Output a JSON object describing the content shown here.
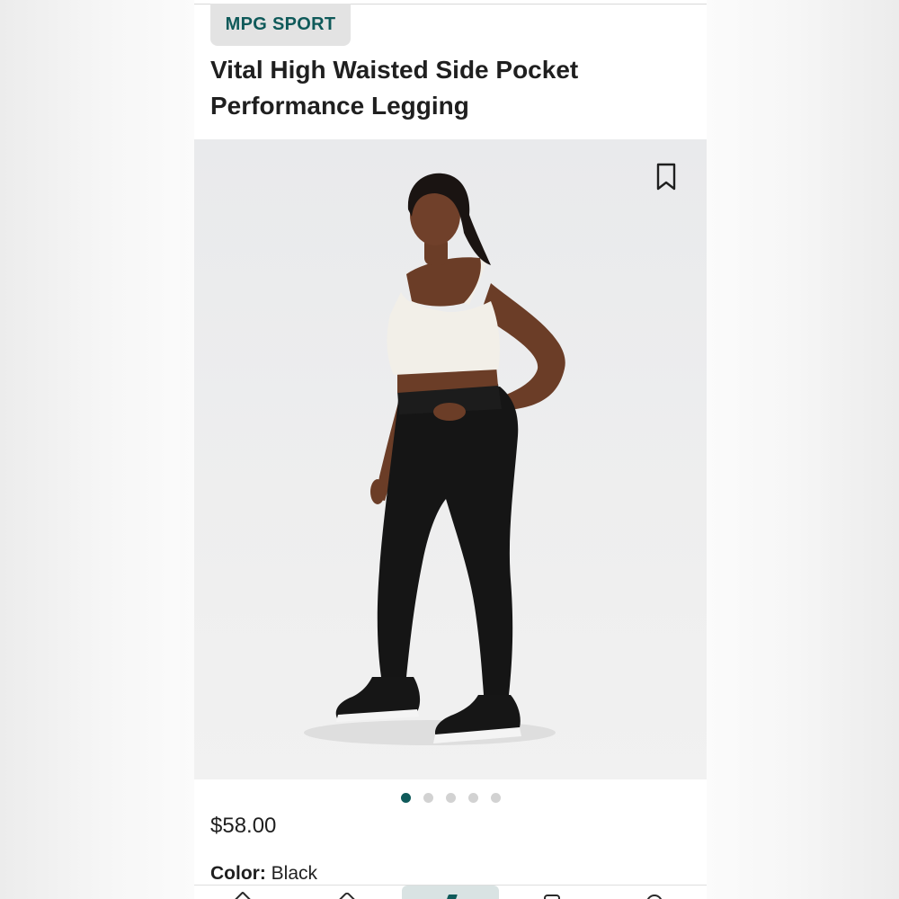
{
  "brand": {
    "label": "MPG SPORT"
  },
  "product": {
    "title": "Vital High Waisted Side Pocket Performance Legging",
    "price": "$58.00",
    "color_label": "Color:",
    "color_value": "Black"
  },
  "gallery": {
    "image_count": 5,
    "active_index": 0,
    "bookmark_icon": "bookmark-icon"
  },
  "bottom_nav": {
    "items": [
      "home-icon",
      "shop-icon",
      "sell-icon",
      "news-icon",
      "profile-icon"
    ],
    "active_index": 2
  },
  "colors": {
    "brand_accent": "#0f5a5a",
    "pill_bg": "#e3e3e3",
    "text": "#1f1f1f"
  }
}
